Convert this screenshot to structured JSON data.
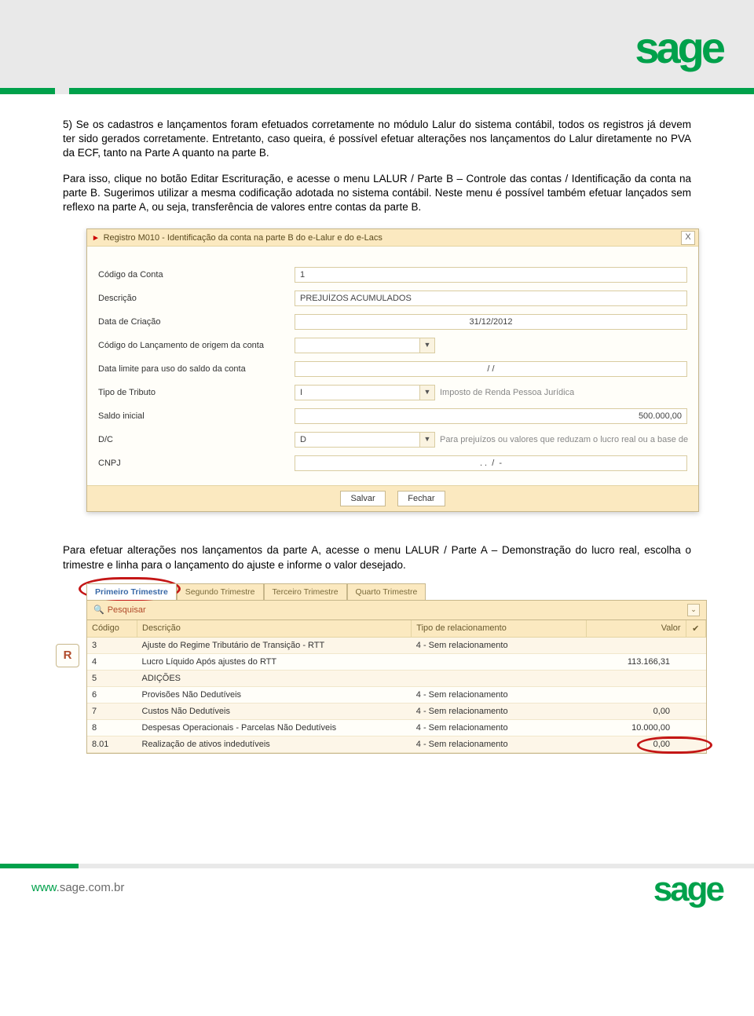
{
  "brand": {
    "name": "sage",
    "url_www": "www",
    "url_rest": ".sage.com.br"
  },
  "paragraphs": {
    "p1": "5) Se os cadastros e lançamentos foram efetuados corretamente no módulo Lalur do sistema contábil, todos os registros já devem ter sido gerados corretamente. Entretanto, caso queira, é possível efetuar alterações nos lançamentos do Lalur diretamente no PVA da ECF, tanto na Parte A quanto na parte B.",
    "p2": "Para isso, clique no botão Editar Escrituração, e acesse o menu LALUR / Parte B – Controle das contas / Identificação da conta na parte B. Sugerimos utilizar a mesma codificação adotada no sistema contábil. Neste menu é possível também efetuar lançados sem reflexo na parte A, ou seja, transferência de valores entre contas da parte B.",
    "p3": "Para efetuar alterações nos lançamentos da parte A, acesse o menu LALUR / Parte A – Demonstração do lucro real, escolha o trimestre e linha para o lançamento do ajuste e informe o valor desejado."
  },
  "dialog": {
    "title": "Registro M010 - Identificação da conta na parte B do e-Lalur e do e-Lacs",
    "close": "X",
    "fields": {
      "codigo_label": "Código da Conta",
      "codigo_value": "1",
      "descricao_label": "Descrição",
      "descricao_value": "PREJUÍZOS ACUMULADOS",
      "data_criacao_label": "Data de Criação",
      "data_criacao_value": "31/12/2012",
      "cod_lanc_origem_label": "Código do Lançamento de origem da conta",
      "cod_lanc_origem_value": "",
      "data_limite_label": "Data limite para uso do saldo da conta",
      "data_limite_value": "/ /",
      "tipo_tributo_label": "Tipo de Tributo",
      "tipo_tributo_value": "I",
      "tipo_tributo_aux": "Imposto de Renda Pessoa Jurídica",
      "saldo_inicial_label": "Saldo inicial",
      "saldo_inicial_value": "500.000,00",
      "dc_label": "D/C",
      "dc_value": "D",
      "dc_aux": "Para prejuízos ou valores que reduzam o lucro real ou a base de",
      "cnpj_label": "CNPJ",
      "cnpj_value": ". .  /  -"
    },
    "buttons": {
      "save": "Salvar",
      "close_btn": "Fechar"
    }
  },
  "tabs": {
    "t1": "Primeiro Trimestre",
    "t2": "Segundo Trimestre",
    "t3": "Terceiro Trimestre",
    "t4": "Quarto Trimestre",
    "search": "Pesquisar",
    "r_badge": "R"
  },
  "grid": {
    "headers": {
      "codigo": "Código",
      "descricao": "Descrição",
      "tipo": "Tipo de relacionamento",
      "valor": "Valor",
      "chk": "✔"
    },
    "rows": [
      {
        "codigo": "3",
        "descricao": "Ajuste do Regime Tributário de Transição - RTT",
        "tipo": "4 - Sem relacionamento",
        "valor": ""
      },
      {
        "codigo": "4",
        "descricao": "Lucro Líquido Após ajustes do RTT",
        "tipo": "",
        "valor": "113.166,31"
      },
      {
        "codigo": "5",
        "descricao": "ADIÇÕES",
        "tipo": "",
        "valor": ""
      },
      {
        "codigo": "6",
        "descricao": "Provisões Não Dedutíveis",
        "tipo": "4 - Sem relacionamento",
        "valor": ""
      },
      {
        "codigo": "7",
        "descricao": "Custos Não Dedutíveis",
        "tipo": "4 - Sem relacionamento",
        "valor": "0,00"
      },
      {
        "codigo": "8",
        "descricao": "Despesas Operacionais - Parcelas Não Dedutíveis",
        "tipo": "4 - Sem relacionamento",
        "valor": "10.000,00"
      },
      {
        "codigo": "8.01",
        "descricao": "Realização de ativos indedutíveis",
        "tipo": "4 - Sem relacionamento",
        "valor": "0,00"
      }
    ]
  }
}
